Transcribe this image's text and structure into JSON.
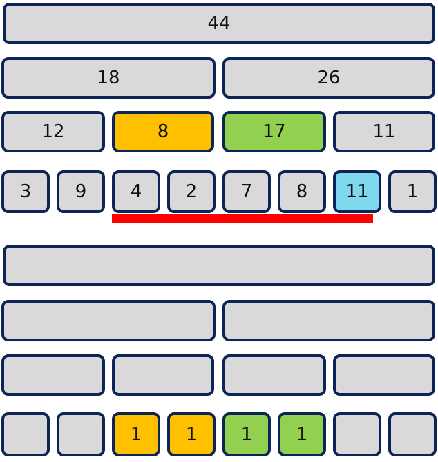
{
  "colors": {
    "default_fill": "#d9d9d9",
    "border": "#0d2457",
    "orange": "#ffc000",
    "green": "#92d050",
    "blue": "#7fd8ee",
    "underline": "#ff0000"
  },
  "top_tree": {
    "level0": [
      {
        "value": "44",
        "fill": "default"
      }
    ],
    "level1": [
      {
        "value": "18",
        "fill": "default"
      },
      {
        "value": "26",
        "fill": "default"
      }
    ],
    "level2": [
      {
        "value": "12",
        "fill": "default"
      },
      {
        "value": "8",
        "fill": "orange"
      },
      {
        "value": "17",
        "fill": "green"
      },
      {
        "value": "11",
        "fill": "default"
      }
    ],
    "leaves": [
      {
        "value": "3",
        "fill": "default"
      },
      {
        "value": "9",
        "fill": "default"
      },
      {
        "value": "4",
        "fill": "default"
      },
      {
        "value": "2",
        "fill": "default"
      },
      {
        "value": "7",
        "fill": "default"
      },
      {
        "value": "8",
        "fill": "default"
      },
      {
        "value": "11",
        "fill": "blue"
      },
      {
        "value": "1",
        "fill": "default"
      }
    ]
  },
  "bottom_tree": {
    "level0": [
      {
        "value": "",
        "fill": "default"
      }
    ],
    "level1": [
      {
        "value": "",
        "fill": "default"
      },
      {
        "value": "",
        "fill": "default"
      }
    ],
    "level2": [
      {
        "value": "",
        "fill": "default"
      },
      {
        "value": "",
        "fill": "default"
      },
      {
        "value": "",
        "fill": "default"
      },
      {
        "value": "",
        "fill": "default"
      }
    ],
    "leaves": [
      {
        "value": "",
        "fill": "default"
      },
      {
        "value": "",
        "fill": "default"
      },
      {
        "value": "1",
        "fill": "orange"
      },
      {
        "value": "1",
        "fill": "orange"
      },
      {
        "value": "1",
        "fill": "green"
      },
      {
        "value": "1",
        "fill": "green"
      },
      {
        "value": "",
        "fill": "default"
      },
      {
        "value": "",
        "fill": "default"
      }
    ]
  }
}
